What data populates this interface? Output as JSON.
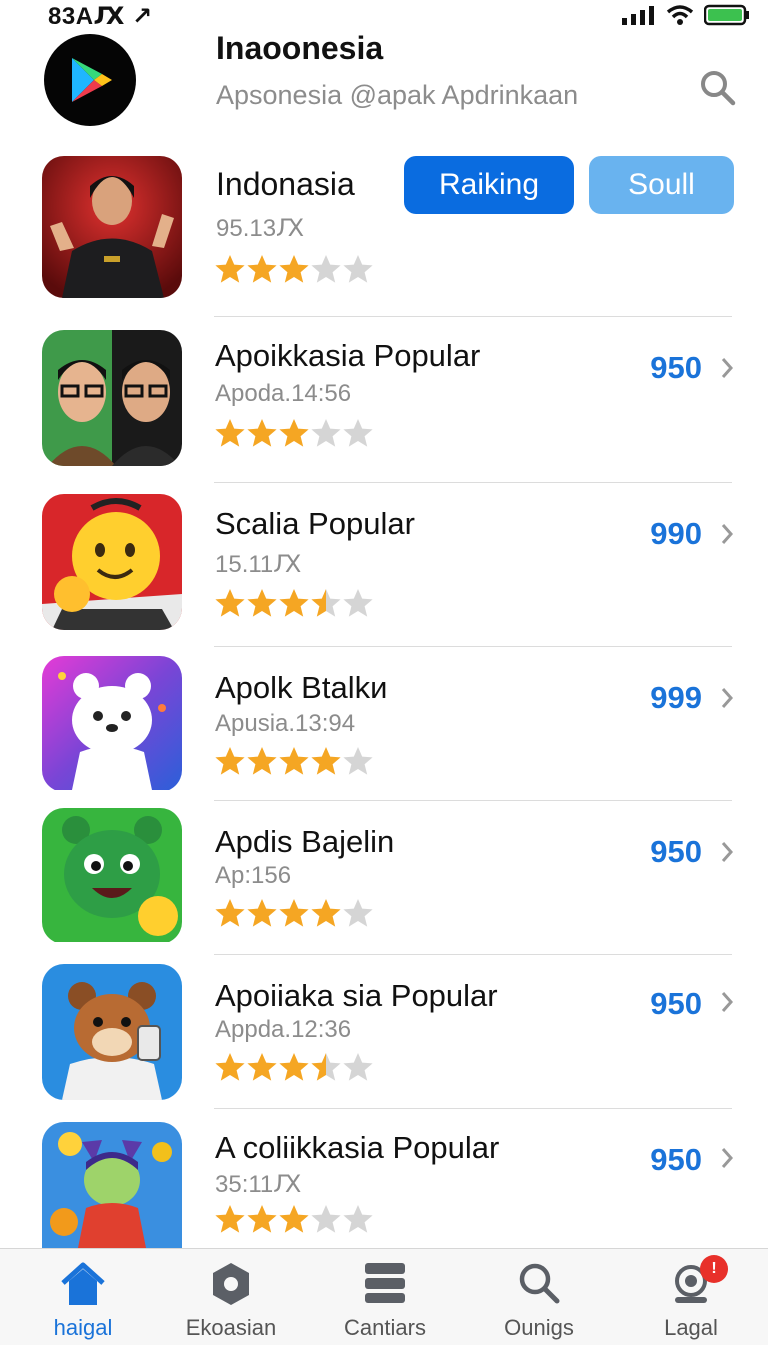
{
  "status_bar": {
    "time": "83AԔ ↗",
    "signal_icon": "signal-bars-icon",
    "wifi_icon": "wifi-icon",
    "battery_icon": "battery-icon"
  },
  "header": {
    "title": "Inaoonesia",
    "subtitle": "Apsonesia @apak Apdrinkaan",
    "logo_icon": "play-store-icon",
    "search_icon": "search-icon"
  },
  "featured": {
    "name": "Indonasia",
    "sub": "95.13Ԕ",
    "rating": 3,
    "primary_button": "Raiking",
    "secondary_button": "Soull"
  },
  "apps": [
    {
      "name": "Apoikkasia Popular",
      "sub": "Apoda.14:56",
      "rating": 3,
      "price": "950"
    },
    {
      "name": "Scalia Popular",
      "sub": "15.11Ԕ",
      "rating": 3.5,
      "price": "990"
    },
    {
      "name": "Apolk Btalkи",
      "sub": "Apusia.13:94",
      "rating": 4,
      "price": "999"
    },
    {
      "name": "Apdis Bajelin",
      "sub": "Ap:156",
      "rating": 4,
      "price": "950"
    },
    {
      "name": "Apoiiaka sia Popular",
      "sub": "Appda.12:36",
      "rating": 3.5,
      "price": "950"
    },
    {
      "name": "A coliikkasia Popular",
      "sub": "35:11Ԕ",
      "rating": 3,
      "price": "950"
    }
  ],
  "tabbar": {
    "tabs": [
      {
        "label": "haigal",
        "icon": "home-icon",
        "active": true
      },
      {
        "label": "Ekoasian",
        "icon": "apps-icon",
        "active": false
      },
      {
        "label": "Cantiars",
        "icon": "list-icon",
        "active": false
      },
      {
        "label": "Ounigs",
        "icon": "search-icon",
        "active": false
      },
      {
        "label": "Lagal",
        "icon": "account-icon",
        "active": false
      }
    ],
    "badge": "!"
  },
  "colors": {
    "accent": "#1a73d9",
    "primary_button": "#0a6ce0",
    "secondary_button": "#69b3ef",
    "star": "#f5a623",
    "star_empty": "#d5d5d5",
    "badge": "#e8302a"
  }
}
